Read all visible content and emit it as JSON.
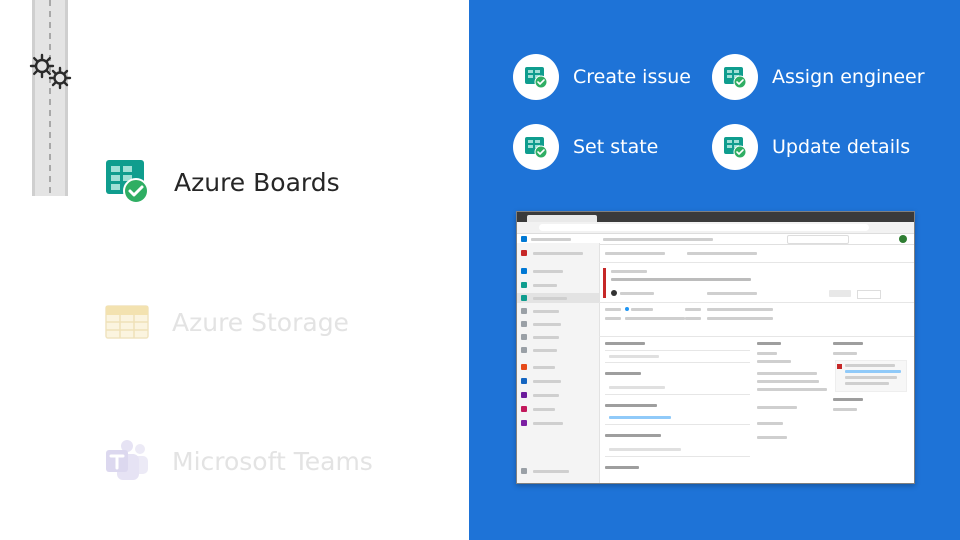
{
  "services": [
    {
      "label": "Azure Boards",
      "state": "active"
    },
    {
      "label": "Azure Storage",
      "state": "dim"
    },
    {
      "label": "Microsoft Teams",
      "state": "dim"
    }
  ],
  "actions": [
    {
      "label": "Create issue"
    },
    {
      "label": "Assign engineer"
    },
    {
      "label": "Set state"
    },
    {
      "label": "Update details"
    }
  ],
  "colors": {
    "panel_blue": "#1e73d7",
    "boards_green": "#0f9d8e",
    "check_green": "#2fae63",
    "dim_text": "#e3e3e3"
  },
  "icons": [
    "gears-icon",
    "azure-boards-icon",
    "azure-storage-icon",
    "microsoft-teams-icon",
    "boards-check-icon"
  ]
}
